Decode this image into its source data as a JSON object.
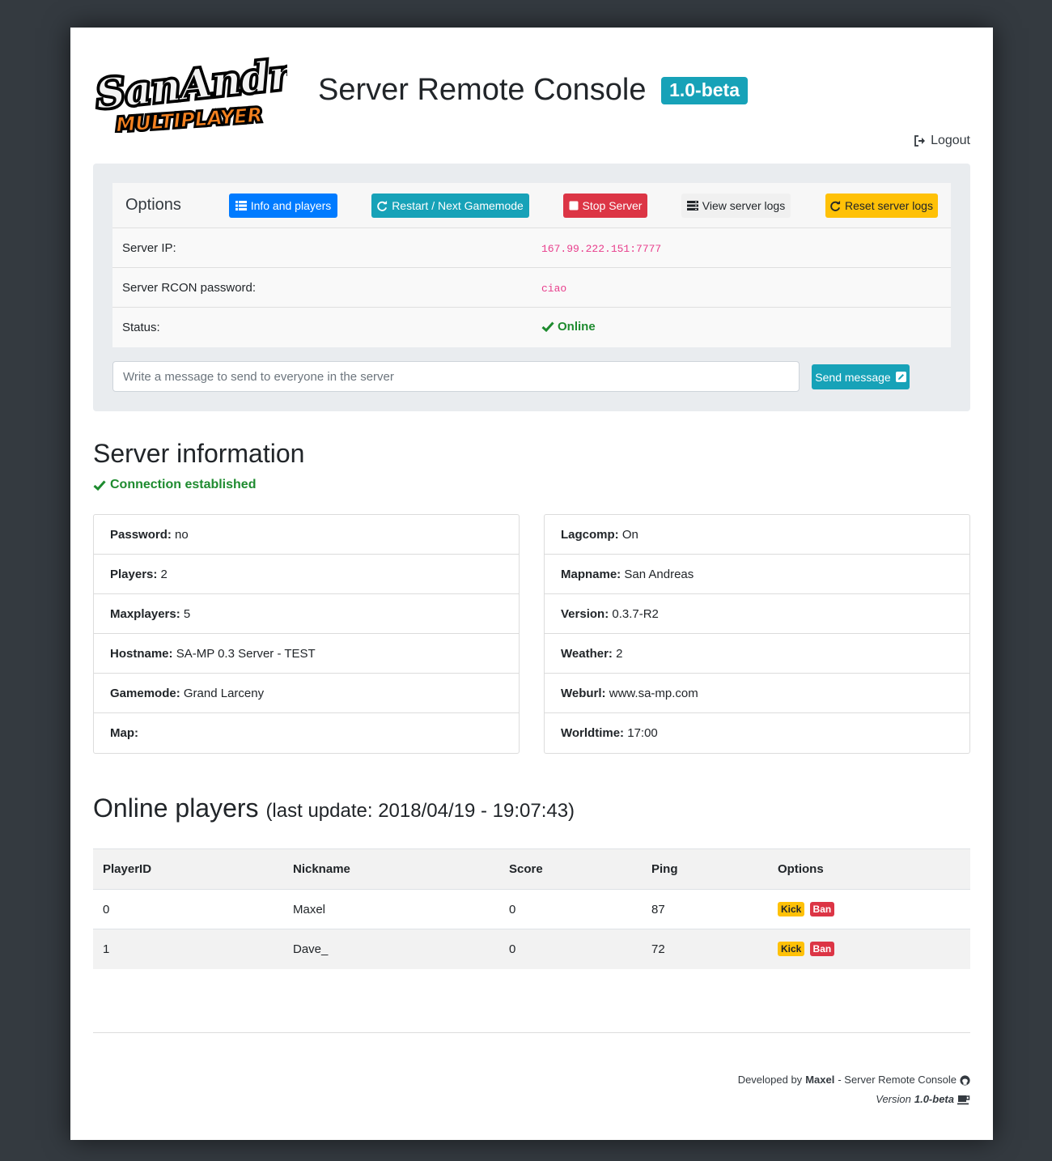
{
  "header": {
    "logo_line1": "SanAndreas",
    "logo_line2": "MULTIPLAYER",
    "title": "Server Remote Console",
    "version_badge": "1.0-beta",
    "logout_label": "Logout"
  },
  "options": {
    "title": "Options",
    "buttons": [
      {
        "label": "Info and players",
        "icon": "list-icon"
      },
      {
        "label": "Restart / Next Gamemode",
        "icon": "redo-icon"
      },
      {
        "label": "Stop Server",
        "icon": "stop-icon"
      },
      {
        "label": "View server logs",
        "icon": "server-icon"
      },
      {
        "label": "Reset server logs",
        "icon": "redo-icon"
      }
    ],
    "rows": [
      {
        "label": "Server IP:",
        "value": "167.99.222.151:7777"
      },
      {
        "label": "Server RCON password:",
        "value": "ciao"
      },
      {
        "label": "Status:",
        "value": "Online"
      }
    ],
    "message_placeholder": "Write a message to send to everyone in the server",
    "send_label": "Send message"
  },
  "server_info": {
    "heading": "Server information",
    "connection": "Connection established",
    "left": [
      {
        "key": "Password:",
        "value": "no"
      },
      {
        "key": "Players:",
        "value": "2"
      },
      {
        "key": "Maxplayers:",
        "value": "5"
      },
      {
        "key": "Hostname:",
        "value": "SA-MP 0.3 Server - TEST"
      },
      {
        "key": "Gamemode:",
        "value": "Grand Larceny"
      },
      {
        "key": "Map:",
        "value": ""
      }
    ],
    "right": [
      {
        "key": "Lagcomp:",
        "value": "On"
      },
      {
        "key": "Mapname:",
        "value": "San Andreas"
      },
      {
        "key": "Version:",
        "value": "0.3.7-R2"
      },
      {
        "key": "Weather:",
        "value": "2"
      },
      {
        "key": "Weburl:",
        "value": "www.sa-mp.com"
      },
      {
        "key": "Worldtime:",
        "value": "17:00"
      }
    ]
  },
  "players": {
    "heading": "Online players",
    "subheading": "(last update: 2018/04/19 - 19:07:43)",
    "columns": [
      "PlayerID",
      "Nickname",
      "Score",
      "Ping",
      "Options"
    ],
    "rows": [
      {
        "id": "0",
        "nickname": "Maxel",
        "score": "0",
        "ping": "87"
      },
      {
        "id": "1",
        "nickname": "Dave_",
        "score": "0",
        "ping": "72"
      }
    ],
    "kick_label": "Kick",
    "ban_label": "Ban"
  },
  "footer": {
    "developed_by": "Developed by",
    "author": "Maxel",
    "project": "- Server Remote Console",
    "version_prefix": "Version",
    "version": "1.0-beta"
  },
  "colors": {
    "background": "#343a40",
    "primary": "#007bff",
    "info": "#17a2b8",
    "danger": "#dc3545",
    "warning": "#ffc107",
    "success": "#1e8b2f"
  }
}
